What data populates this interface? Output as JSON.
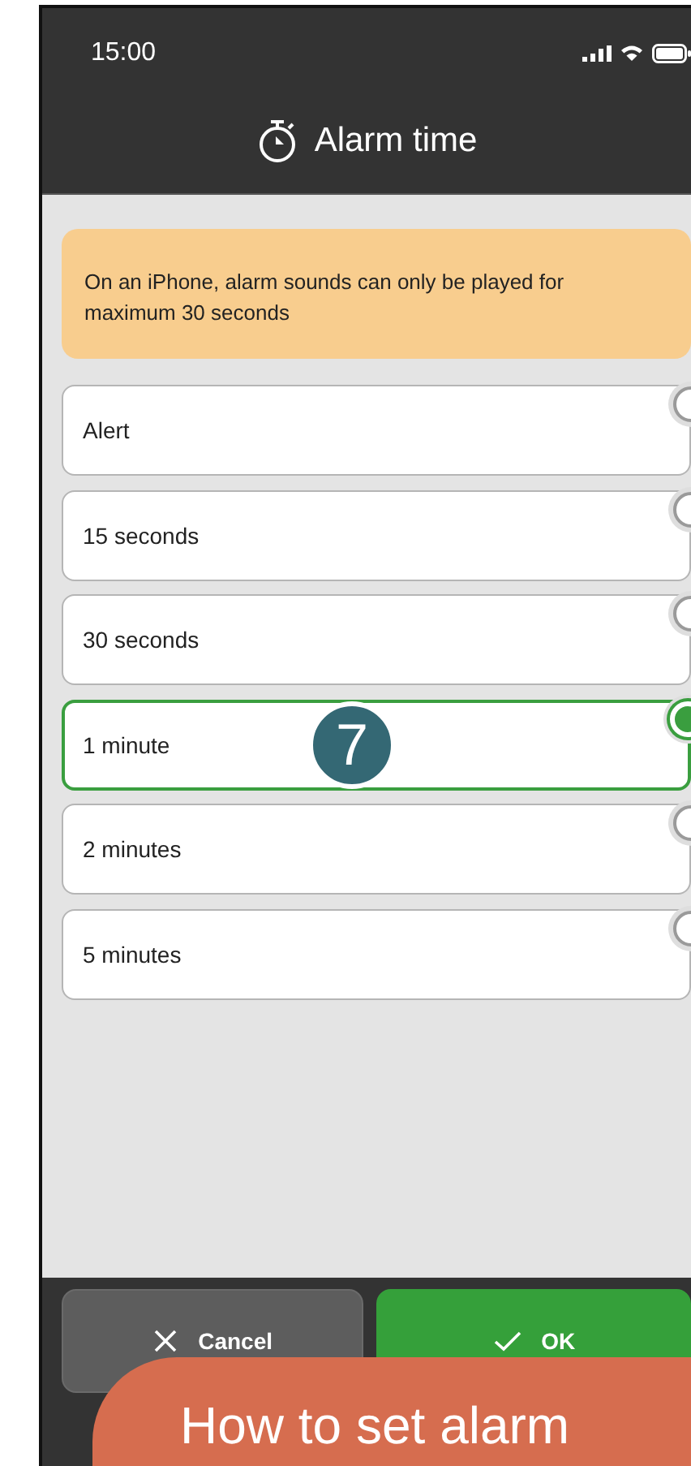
{
  "status_bar": {
    "time": "15:00"
  },
  "header": {
    "title": "Alarm time"
  },
  "notice": "On an iPhone, alarm sounds can only be played for maximum 30 seconds",
  "options": [
    {
      "label": "Alert",
      "selected": false
    },
    {
      "label": "15 seconds",
      "selected": false
    },
    {
      "label": "30 seconds",
      "selected": false
    },
    {
      "label": "1 minute",
      "selected": true
    },
    {
      "label": "2 minutes",
      "selected": false
    },
    {
      "label": "5 minutes",
      "selected": false
    }
  ],
  "buttons": [
    {
      "kind": "cancel",
      "label": "Cancel"
    },
    {
      "kind": "ok",
      "label": "OK"
    }
  ],
  "step_badge": "7",
  "banner": {
    "title": "How to set alarm"
  }
}
